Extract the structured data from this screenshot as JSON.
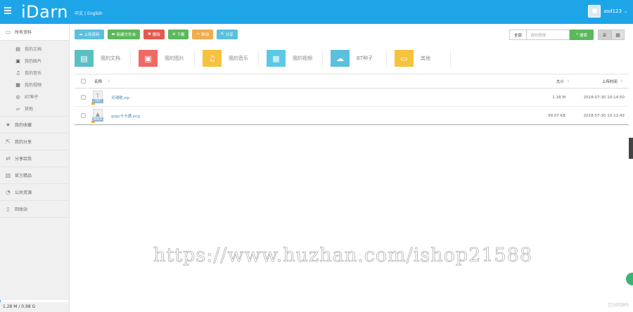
{
  "app": {
    "logo_text": "iDarn",
    "lang_zh": "中文",
    "lang_sep": "|",
    "lang_en": "English",
    "username": "asd123"
  },
  "sidebar": {
    "all_files": "所有资料",
    "sub_items": [
      {
        "label": "我的文档",
        "icon": "document-icon"
      },
      {
        "label": "我的图片",
        "icon": "image-icon"
      },
      {
        "label": "我的音乐",
        "icon": "music-icon"
      },
      {
        "label": "我的视频",
        "icon": "video-icon"
      },
      {
        "label": "BT种子",
        "icon": "torrent-icon"
      },
      {
        "label": "其他",
        "icon": "folder-open-icon"
      }
    ],
    "items": [
      {
        "label": "我的收藏",
        "icon": "star-icon"
      },
      {
        "label": "我的分享",
        "icon": "share-icon"
      },
      {
        "label": "分享给我",
        "icon": "transfer-icon"
      },
      {
        "label": "官方精品",
        "icon": "gift-icon"
      },
      {
        "label": "公共资源",
        "icon": "rss-icon"
      },
      {
        "label": "回收站",
        "icon": "trash-icon"
      }
    ],
    "storage": {
      "text": "1.28 M / 0.98 G",
      "fraction": 0.013
    }
  },
  "toolbar": {
    "upload": "上传资料",
    "new_folder": "新建文件夹",
    "delete": "删除",
    "download": "下载",
    "move": "移动",
    "share": "分享"
  },
  "search": {
    "scope": "全部",
    "placeholder": "请你想搜",
    "button": "搜索"
  },
  "categories": [
    {
      "label": "我的文档",
      "color": "#5bc0c4",
      "icon": "document-icon",
      "glyph": "▤"
    },
    {
      "label": "我的图片",
      "color": "#f06a65",
      "icon": "image-icon",
      "glyph": "▣"
    },
    {
      "label": "我的音乐",
      "color": "#f7c23e",
      "icon": "music-icon",
      "glyph": "♫"
    },
    {
      "label": "我的视频",
      "color": "#5bc8e6",
      "icon": "video-icon",
      "glyph": "▦"
    },
    {
      "label": "BT种子",
      "color": "#5bc0de",
      "icon": "cloud-download-icon",
      "glyph": "☁"
    },
    {
      "label": "其他",
      "color": "#f7c23e",
      "icon": "folder-open-icon",
      "glyph": "▭"
    }
  ],
  "table": {
    "col_name": "名称",
    "col_size": "大小",
    "col_date": "上传时间",
    "rows": [
      {
        "name": "灵魂歌.zip",
        "size": "1.18 M",
        "date": "2018-07-30 10:14:50",
        "tag": "TXT",
        "glyph": "T"
      },
      {
        "name": "gtgy卡卡通.png",
        "size": "99.07 KB",
        "date": "2018-07-30 10:12:42",
        "tag": "IMAGE",
        "glyph": "▲"
      }
    ]
  },
  "watermark": {
    "text": "https://www.huzhan.com/ishop21588",
    "corner": "互站网源码"
  }
}
